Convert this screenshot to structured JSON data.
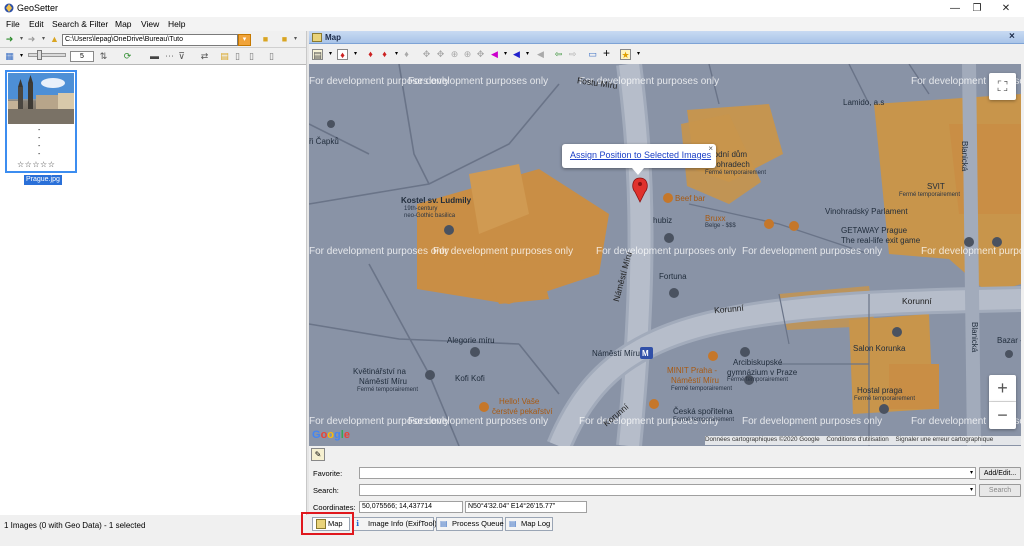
{
  "window": {
    "title": "GeoSetter",
    "minimize": "—",
    "maximize": "❐",
    "close": "✕"
  },
  "menu": [
    "File",
    "Edit",
    "Search & Filter",
    "Map",
    "View",
    "Help"
  ],
  "left_toolbar": {
    "path": "C:\\Users\\lepag\\OneDrive\\Bureau\\Tuto",
    "size_value": "5"
  },
  "thumbnail": {
    "filename": "Prague.jpg",
    "meta_lines": [
      "-",
      "-",
      "-",
      "-"
    ],
    "stars": "☆☆☆☆☆"
  },
  "status": "1 Images (0 with Geo Data) - 1 selected",
  "map_panel": {
    "header": "Map",
    "close": "×",
    "popup_link": "Assign Position to Selected Images",
    "popup_close": "×",
    "watermark": "For development purposes only",
    "attribution": [
      "Données cartographiques ©2020 Google",
      "Conditions d'utilisation",
      "Signaler une erreur cartographique"
    ],
    "google": "Google",
    "zoom_in": "+",
    "zoom_out": "−",
    "fullscreen": "⛶",
    "labels": {
      "kostel": "Kostel sv. Ludmily",
      "kostel_sub1": "19th-century",
      "kostel_sub2": "neo-Gothic basilica",
      "prodni": "rodní dům",
      "vinohrady": "Vinohradech",
      "ferme1": "Fermé temporairement",
      "beef": "Beef bar",
      "hubiz": "hubiz",
      "bruxx": "Bruxx",
      "bruxx_sub": "Belge - $$$",
      "vinoparl": "Vinohradský Parlament",
      "getaway": "GETAWAY Prague",
      "getaway_sub": "The real-life exit game",
      "svit": "SVIT",
      "svit_sub": "Fermé temporairement",
      "lamido": "Lamido, a.s",
      "fortuna": "Fortuna",
      "korunni1": "Korunní",
      "korunni2": "Korunní",
      "korunni3": "Korunní",
      "namesti": "Náměstí Míru",
      "namesti_road": "Náměstí Míru",
      "alegorie": "Alegorie míru",
      "kvet": "Květinářství na",
      "kvet2": "Náměstí Míru",
      "kvet_sub": "Fermé temporairement",
      "kofi": "Kofi Kofi",
      "hello": "Hello! Vaše",
      "hello2": "čerstvé pekařství",
      "minit": "MINIT Praha -",
      "minit2": "Náměstí Míru",
      "minit_sub": "Fermé temporairement",
      "arcib": "Arcibiskupské",
      "arcib2": "gymnázium v Praze",
      "arcib_sub": "Fermé temporairement",
      "salon": "Salon Korunka",
      "hostal": "Hostal praga",
      "hostal_sub": "Fermé temporairement",
      "ceska": "Česká spořitelna",
      "ceska_sub": "Fermé temporairement",
      "capk": "ři Čapků",
      "blanicka": "Blanická",
      "blanicka2": "Blanická",
      "bazar": "Bazar -",
      "m_label": "M",
      "fostu": "Fostu Míru"
    }
  },
  "bottom": {
    "favorite_label": "Favorite:",
    "search_label": "Search:",
    "coords_label": "Coordinates:",
    "coords_decimal": "50,075566; 14,437714",
    "coords_dms": "N50°4'32.04\" E14°26'15.77\"",
    "add_edit": "Add/Edit...",
    "search_btn": "Search"
  },
  "tabs": [
    "Map",
    "Image Info (ExifTool)",
    "Process Queue",
    "Map Log"
  ]
}
